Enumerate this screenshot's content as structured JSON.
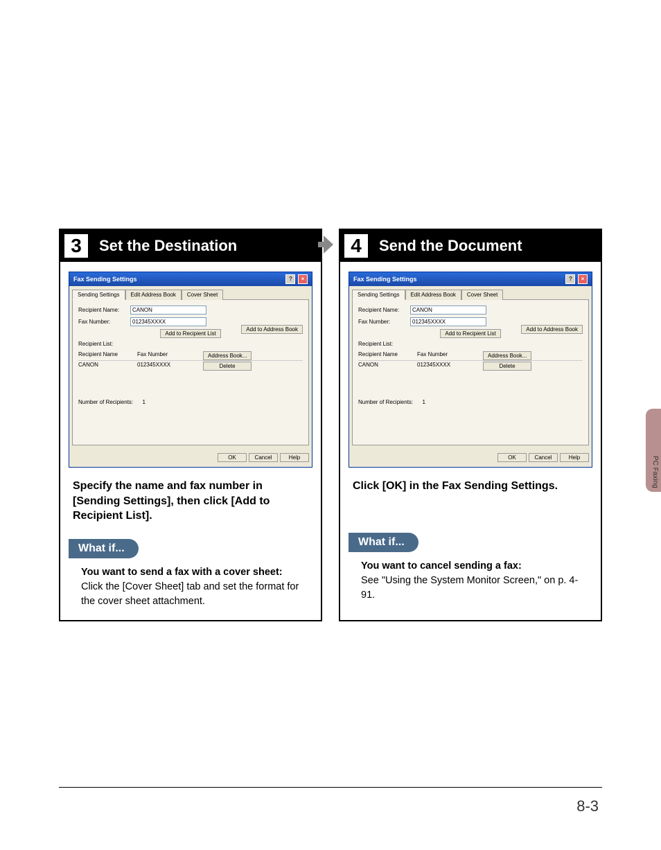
{
  "side_tab_label": "PC Faxing",
  "page_number": "8-3",
  "arrow_icon": "right-arrow",
  "steps": [
    {
      "number": "3",
      "title": "Set the Destination",
      "instruction": "Specify the name and fax number in [Sending Settings], then click [Add to Recipient List].",
      "whatif_label": "What if...",
      "whatif_heading": "You want to send a fax with a cover sheet:",
      "whatif_text": "Click the [Cover Sheet] tab and set the format for the cover sheet attachment."
    },
    {
      "number": "4",
      "title": "Send the Document",
      "instruction": "Click [OK] in the Fax Sending Settings.",
      "whatif_label": "What if...",
      "whatif_heading": "You want to cancel sending a fax:",
      "whatif_text": "See \"Using the System Monitor Screen,\" on p. 4-91."
    }
  ],
  "dialog": {
    "title": "Fax Sending Settings",
    "help_icon": "?",
    "close_icon": "×",
    "tabs": [
      "Sending Settings",
      "Edit Address Book",
      "Cover Sheet"
    ],
    "active_tab_index": 0,
    "recipient_name_label": "Recipient Name:",
    "recipient_name_value": "CANON",
    "fax_number_label": "Fax Number:",
    "fax_number_value": "012345XXXX",
    "add_to_address_book": "Add to Address Book",
    "add_to_recipient_list": "Add to Recipient List",
    "recipient_list_label": "Recipient List:",
    "col_recipient_name": "Recipient Name",
    "col_fax_number": "Fax Number",
    "address_book_btn": "Address Book...",
    "delete_btn": "Delete",
    "rows": [
      {
        "name": "CANON",
        "fax": "012345XXXX"
      }
    ],
    "number_of_recipients_label": "Number of Recipients:",
    "number_of_recipients_value": "1",
    "ok": "OK",
    "cancel": "Cancel",
    "help": "Help"
  }
}
